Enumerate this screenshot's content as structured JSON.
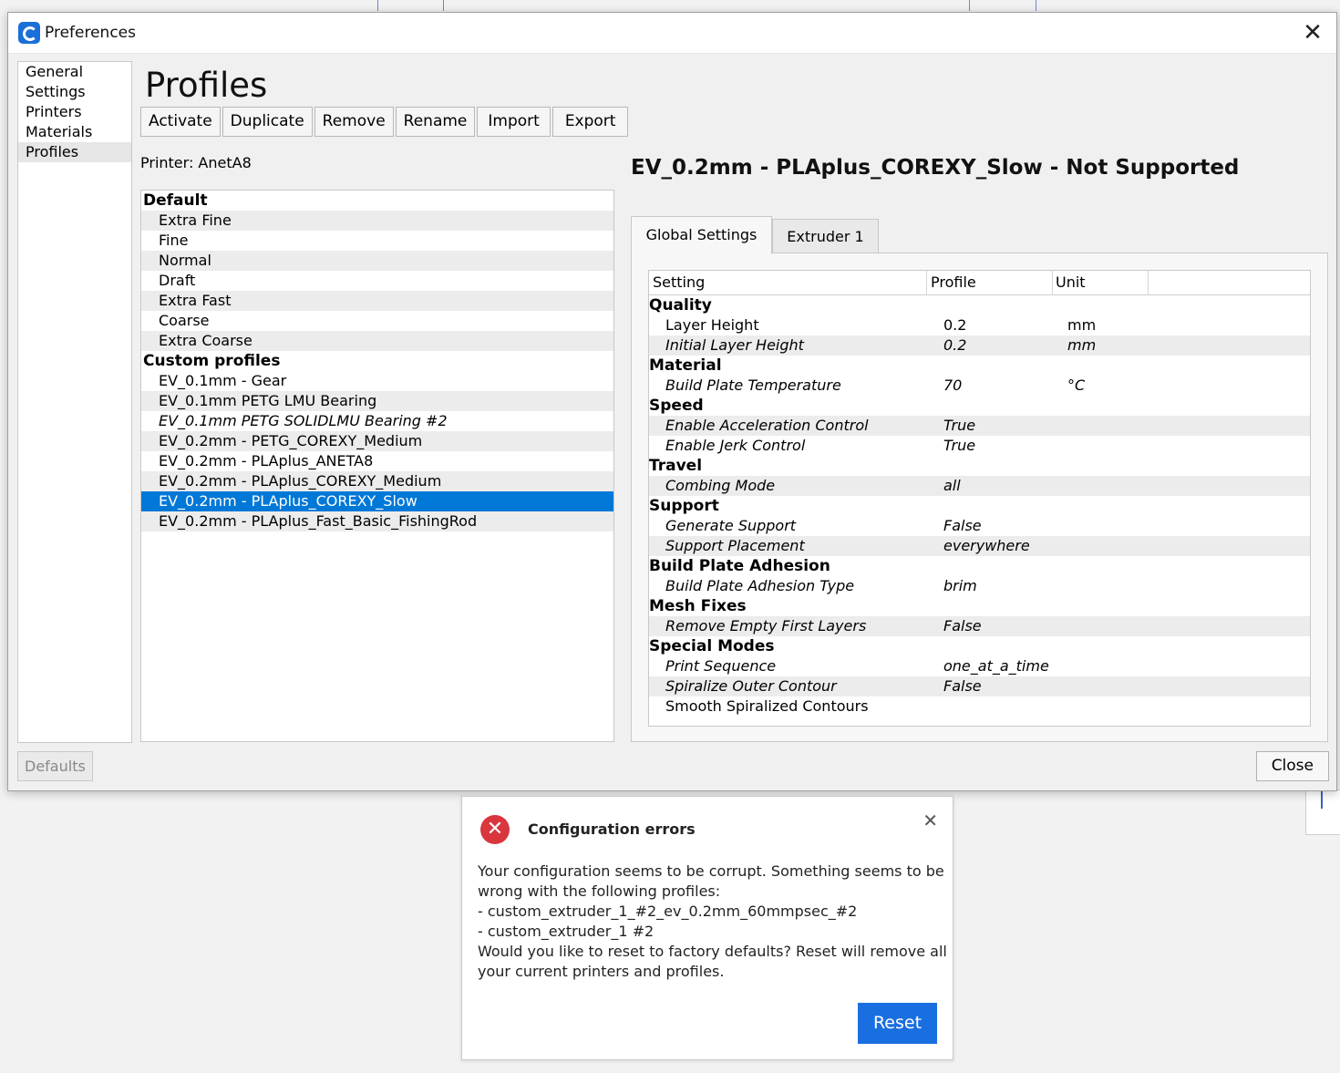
{
  "window": {
    "title": "Preferences",
    "close_icon": "close-icon"
  },
  "nav": {
    "items": [
      {
        "label": "General"
      },
      {
        "label": "Settings"
      },
      {
        "label": "Printers"
      },
      {
        "label": "Materials"
      },
      {
        "label": "Profiles",
        "selected": true
      }
    ]
  },
  "page": {
    "heading": "Profiles",
    "printer_label": "Printer: AnetA8",
    "profile_title": "EV_0.2mm - PLAplus_COREXY_Slow - Not Supported"
  },
  "toolbar": {
    "activate": "Activate",
    "duplicate": "Duplicate",
    "remove": "Remove",
    "rename": "Rename",
    "import": "Import",
    "export": "Export"
  },
  "profiles": {
    "default_header": "Default",
    "default": [
      "Extra Fine",
      "Fine",
      "Normal",
      "Draft",
      "Extra Fast",
      "Coarse",
      "Extra Coarse"
    ],
    "custom_header": "Custom profiles",
    "custom": [
      "EV_0.1mm - Gear",
      "EV_0.1mm PETG LMU Bearing",
      "EV_0.1mm PETG SOLIDLMU Bearing #2",
      "EV_0.2mm - PETG_COREXY_Medium",
      "EV_0.2mm - PLAplus_ANETA8",
      "EV_0.2mm - PLAplus_COREXY_Medium",
      "EV_0.2mm - PLAplus_COREXY_Slow",
      "EV_0.2mm - PLAplus_Fast_Basic_FishingRod"
    ],
    "selected": "EV_0.2mm - PLAplus_COREXY_Slow"
  },
  "tabs": {
    "global": "Global Settings",
    "extruder": "Extruder 1"
  },
  "table": {
    "headers": {
      "setting": "Setting",
      "profile": "Profile",
      "unit": "Unit"
    },
    "rows": [
      {
        "kind": "cat",
        "name": "Quality"
      },
      {
        "name": "Layer Height",
        "value": "0.2",
        "unit": "mm"
      },
      {
        "name": "Initial Layer Height",
        "value": "0.2",
        "unit": "mm",
        "italic": true,
        "alt": true
      },
      {
        "kind": "cat",
        "name": "Material"
      },
      {
        "name": "Build Plate Temperature",
        "value": "70",
        "unit": "°C",
        "italic": true
      },
      {
        "kind": "cat",
        "name": "Speed"
      },
      {
        "name": "Enable Acceleration Control",
        "value": "True",
        "unit": "",
        "italic": true,
        "alt": true
      },
      {
        "name": "Enable Jerk Control",
        "value": "True",
        "unit": "",
        "italic": true
      },
      {
        "kind": "cat",
        "name": "Travel"
      },
      {
        "name": "Combing Mode",
        "value": "all",
        "unit": "",
        "italic": true,
        "alt": true
      },
      {
        "kind": "cat",
        "name": "Support"
      },
      {
        "name": "Generate Support",
        "value": "False",
        "unit": "",
        "italic": true
      },
      {
        "name": "Support Placement",
        "value": "everywhere",
        "unit": "",
        "italic": true,
        "alt": true
      },
      {
        "kind": "cat",
        "name": "Build Plate Adhesion"
      },
      {
        "name": "Build Plate Adhesion Type",
        "value": "brim",
        "unit": "",
        "italic": true
      },
      {
        "kind": "cat",
        "name": "Mesh Fixes"
      },
      {
        "name": "Remove Empty First Layers",
        "value": "False",
        "unit": "",
        "italic": true,
        "alt": true
      },
      {
        "kind": "cat",
        "name": "Special Modes"
      },
      {
        "name": "Print Sequence",
        "value": "one_at_a_time",
        "unit": "",
        "italic": true
      },
      {
        "name": "Spiralize Outer Contour",
        "value": "False",
        "unit": "",
        "italic": true,
        "alt": true
      },
      {
        "name": "Smooth Spiralized Contours",
        "value": "",
        "unit": ""
      }
    ]
  },
  "footer": {
    "defaults": "Defaults",
    "close": "Close"
  },
  "error_dialog": {
    "icon": "error-icon",
    "icon_glyph": "✕",
    "title": "Configuration errors",
    "close_glyph": "✕",
    "lines": [
      "Your configuration seems to be corrupt. Something seems to be",
      "wrong with the following profiles:",
      "- custom_extruder_1_#2_ev_0.2mm_60mmpsec_#2",
      "- custom_extruder_1 #2",
      "Would you like to reset to factory defaults? Reset will remove all",
      "your current printers and profiles."
    ],
    "reset": "Reset"
  },
  "colors": {
    "accent": "#0078d7",
    "reset_button": "#1a6fe0",
    "error_red": "#d9363e"
  }
}
